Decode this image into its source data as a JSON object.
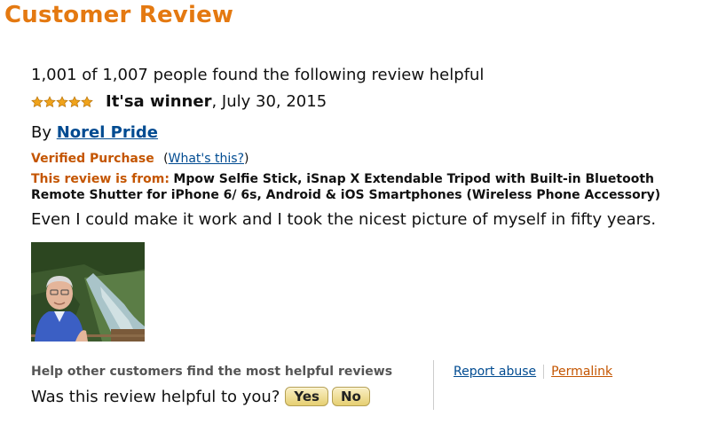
{
  "page": {
    "title": "Customer Review"
  },
  "review": {
    "helpful_count_text": "1,001 of 1,007 people found the following review helpful",
    "rating": 5,
    "rating_max": 5,
    "title": "It'sa winner",
    "date_text": ", July 30, 2015",
    "by_label": "By ",
    "author": "Norel Pride",
    "verified_label": "Verified Purchase",
    "whats_this_open": "(",
    "whats_this_label": "What's this?",
    "whats_this_close": ")",
    "from_label": "This review is from:",
    "product_name": "Mpow Selfie Stick, iSnap X Extendable Tripod with Built-in Bluetooth Remote Shutter for iPhone 6/ 6s, Android & iOS Smartphones (Wireless Phone Accessory)",
    "body": "Even I could make it work and I took the nicest picture of myself in fifty years."
  },
  "feedback": {
    "prompt": "Help other customers find the most helpful reviews",
    "question": "Was this review helpful to you?",
    "yes_label": "Yes",
    "no_label": "No",
    "report_label": "Report abuse",
    "permalink_label": "Permalink"
  },
  "colors": {
    "title_orange": "#e47911",
    "link_blue": "#004b91",
    "verified_orange": "#c45500",
    "star_gold": "#f0a31b"
  },
  "icons": {
    "rating": "star-icon"
  }
}
